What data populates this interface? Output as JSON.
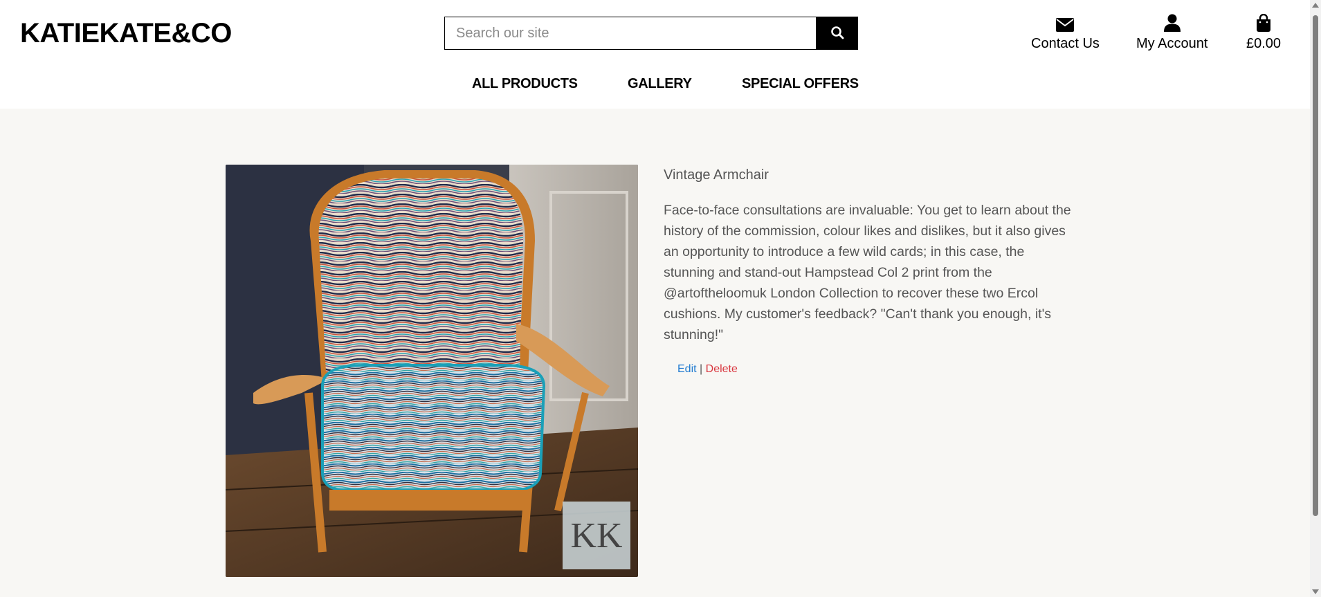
{
  "header": {
    "brand": "KATIEKATE&CO",
    "search": {
      "placeholder": "Search our site",
      "value": ""
    },
    "links": {
      "contact": "Contact Us",
      "account": "My Account",
      "cart_total": "£0.00"
    }
  },
  "nav": {
    "all_products": "ALL PRODUCTS",
    "gallery": "GALLERY",
    "special_offers": "SPECIAL OFFERS"
  },
  "product": {
    "title": "Vintage Armchair",
    "description": "Face-to-face consultations are invaluable: You get to learn about the history of the commission, colour likes and dislikes, but it also gives an opportunity to introduce a few wild cards; in this case, the stunning and stand-out Hampstead Col 2 print from the @artoftheloomuk London Collection to recover these two Ercol cushions. My customer's feedback? \"Can't thank you enough, it's stunning!\"",
    "edit_label": "Edit",
    "separator": "|",
    "delete_label": "Delete",
    "watermark": "KK"
  },
  "colors": {
    "background": "#f8f7f4",
    "header_bg": "#ffffff",
    "edit_link": "#1f7ad0",
    "delete_link": "#d9373f",
    "body_text": "#555555"
  }
}
